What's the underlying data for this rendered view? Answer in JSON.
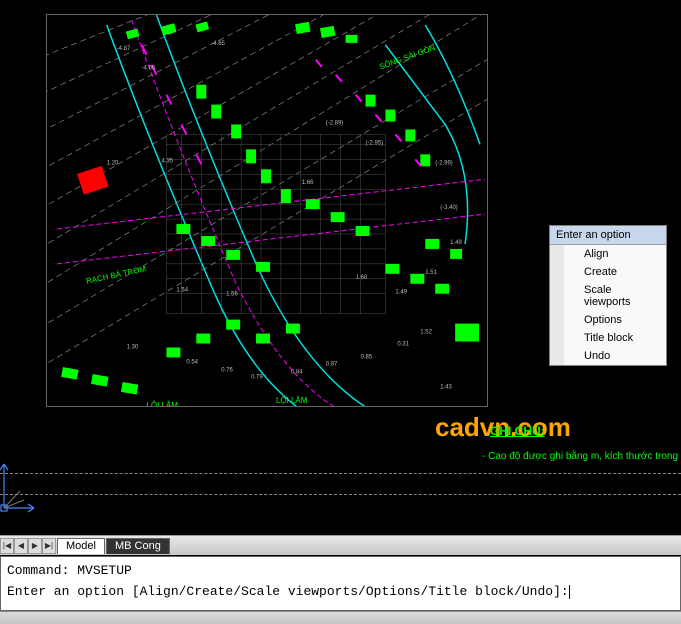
{
  "watermark": "cadvn.com",
  "annotations": {
    "ghi_chu": "GHI CHÚ:",
    "cao_do": "- Cao độ được ghi bằng m, kích thước trong bản vẽ g"
  },
  "tabs": {
    "nav": {
      "first": "|◀",
      "prev": "◀",
      "next": "▶",
      "last": "▶|"
    },
    "items": [
      {
        "label": "Model",
        "active": true
      },
      {
        "label": "MB Cong",
        "active": false
      }
    ]
  },
  "command": {
    "line1": "Command: MVSETUP",
    "line2": "Enter an option [Align/Create/Scale viewports/Options/Title block/Undo]:"
  },
  "context_menu": {
    "title": "Enter an option",
    "items": [
      "Align",
      "Create",
      "Scale viewports",
      "Options",
      "Title block",
      "Undo"
    ]
  }
}
